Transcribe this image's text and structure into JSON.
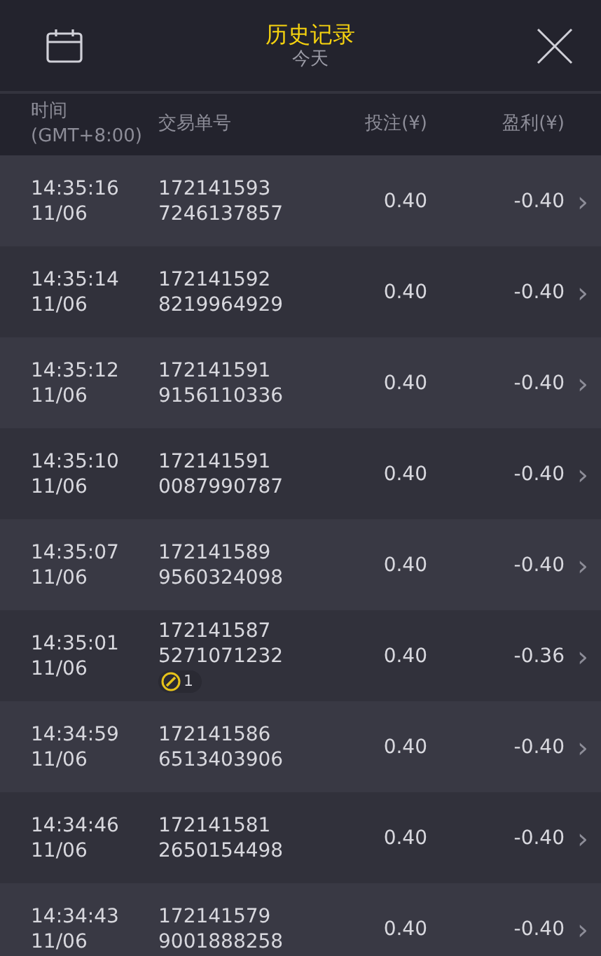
{
  "header": {
    "title": "历史记录",
    "subtitle": "今天"
  },
  "columns": {
    "time": [
      "时间",
      "(GMT+8:00)"
    ],
    "order": "交易单号",
    "stake": "投注(¥)",
    "profit": "盈利(¥)"
  },
  "rows": [
    {
      "time": "14:35:16",
      "date": "11/06",
      "order": [
        "172141593",
        "7246137857"
      ],
      "stake": "0.40",
      "profit": "-0.40",
      "chevron": "›"
    },
    {
      "time": "14:35:14",
      "date": "11/06",
      "order": [
        "172141592",
        "8219964929"
      ],
      "stake": "0.40",
      "profit": "-0.40",
      "chevron": "›"
    },
    {
      "time": "14:35:12",
      "date": "11/06",
      "order": [
        "172141591",
        "9156110336"
      ],
      "stake": "0.40",
      "profit": "-0.40",
      "chevron": "›"
    },
    {
      "time": "14:35:10",
      "date": "11/06",
      "order": [
        "172141591",
        "0087990787"
      ],
      "stake": "0.40",
      "profit": "-0.40",
      "chevron": "›"
    },
    {
      "time": "14:35:07",
      "date": "11/06",
      "order": [
        "172141589",
        "9560324098"
      ],
      "stake": "0.40",
      "profit": "-0.40",
      "chevron": "›"
    },
    {
      "time": "14:35:01",
      "date": "11/06",
      "order": [
        "172141587",
        "5271071232"
      ],
      "badge": "1",
      "stake": "0.40",
      "profit": "-0.36",
      "chevron": "›"
    },
    {
      "time": "14:34:59",
      "date": "11/06",
      "order": [
        "172141586",
        "6513403906"
      ],
      "stake": "0.40",
      "profit": "-0.40",
      "chevron": "›"
    },
    {
      "time": "14:34:46",
      "date": "11/06",
      "order": [
        "172141581",
        "2650154498"
      ],
      "stake": "0.40",
      "profit": "-0.40",
      "chevron": "›"
    },
    {
      "time": "14:34:43",
      "date": "11/06",
      "order": [
        "172141579",
        "9001888258"
      ],
      "stake": "0.40",
      "profit": "-0.40",
      "chevron": "›"
    }
  ]
}
